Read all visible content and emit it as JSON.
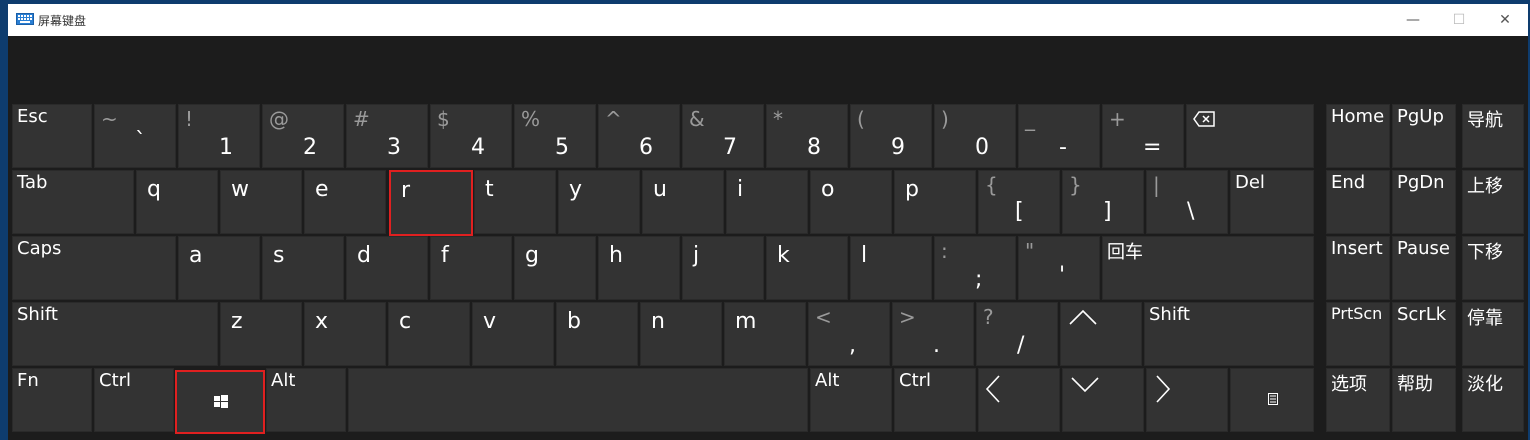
{
  "window": {
    "title": "屏幕键盘",
    "icon": "keyboard-icon",
    "buttons": {
      "minimize": "—",
      "maximize": "☐",
      "close": "✕"
    }
  },
  "highlight_color": "#e02020",
  "row1": [
    {
      "name": "esc",
      "label": "Esc"
    },
    {
      "name": "backtick",
      "top": "~",
      "main": "`"
    },
    {
      "name": "1",
      "top": "!",
      "main": "1"
    },
    {
      "name": "2",
      "top": "@",
      "main": "2"
    },
    {
      "name": "3",
      "top": "#",
      "main": "3"
    },
    {
      "name": "4",
      "top": "$",
      "main": "4"
    },
    {
      "name": "5",
      "top": "%",
      "main": "5"
    },
    {
      "name": "6",
      "top": "^",
      "main": "6"
    },
    {
      "name": "7",
      "top": "&",
      "main": "7"
    },
    {
      "name": "8",
      "top": "*",
      "main": "8"
    },
    {
      "name": "9",
      "top": "(",
      "main": "9"
    },
    {
      "name": "0",
      "top": ")",
      "main": "0"
    },
    {
      "name": "minus",
      "top": "_",
      "main": "-"
    },
    {
      "name": "equals",
      "top": "+",
      "main": "="
    }
  ],
  "row2": {
    "tab": "Tab",
    "letters": [
      "q",
      "w",
      "e",
      "r",
      "t",
      "y",
      "u",
      "i",
      "o",
      "p"
    ],
    "lbracket": {
      "top": "{",
      "main": "["
    },
    "rbracket": {
      "top": "}",
      "main": "]"
    },
    "backslash": {
      "top": "|",
      "main": "\\"
    },
    "del": "Del"
  },
  "row3": {
    "caps": "Caps",
    "letters": [
      "a",
      "s",
      "d",
      "f",
      "g",
      "h",
      "j",
      "k",
      "l"
    ],
    "semicolon": {
      "top": ":",
      "main": ";"
    },
    "quote": {
      "top": "\"",
      "main": "'"
    },
    "enter": "回车"
  },
  "row4": {
    "shift_left": "Shift",
    "letters": [
      "z",
      "x",
      "c",
      "v",
      "b",
      "n",
      "m"
    ],
    "comma": {
      "top": "<",
      "main": ","
    },
    "period": {
      "top": ">",
      "main": "."
    },
    "slash": {
      "top": "?",
      "main": "/"
    },
    "shift_right": "Shift"
  },
  "row5": {
    "fn": "Fn",
    "ctrl_left": "Ctrl",
    "alt_left": "Alt",
    "alt_right": "Alt",
    "ctrl_right": "Ctrl"
  },
  "nav": {
    "home": "Home",
    "pgup": "PgUp",
    "daohang": "导航",
    "end": "End",
    "pgdn": "PgDn",
    "shangyi": "上移",
    "insert": "Insert",
    "pause": "Pause",
    "xiayi": "下移",
    "prtscn": "PrtScn",
    "scrlk": "ScrLk",
    "tingkao": "停靠",
    "xuanxiang": "选项",
    "bangzhu": "帮助",
    "danhua": "淡化"
  }
}
